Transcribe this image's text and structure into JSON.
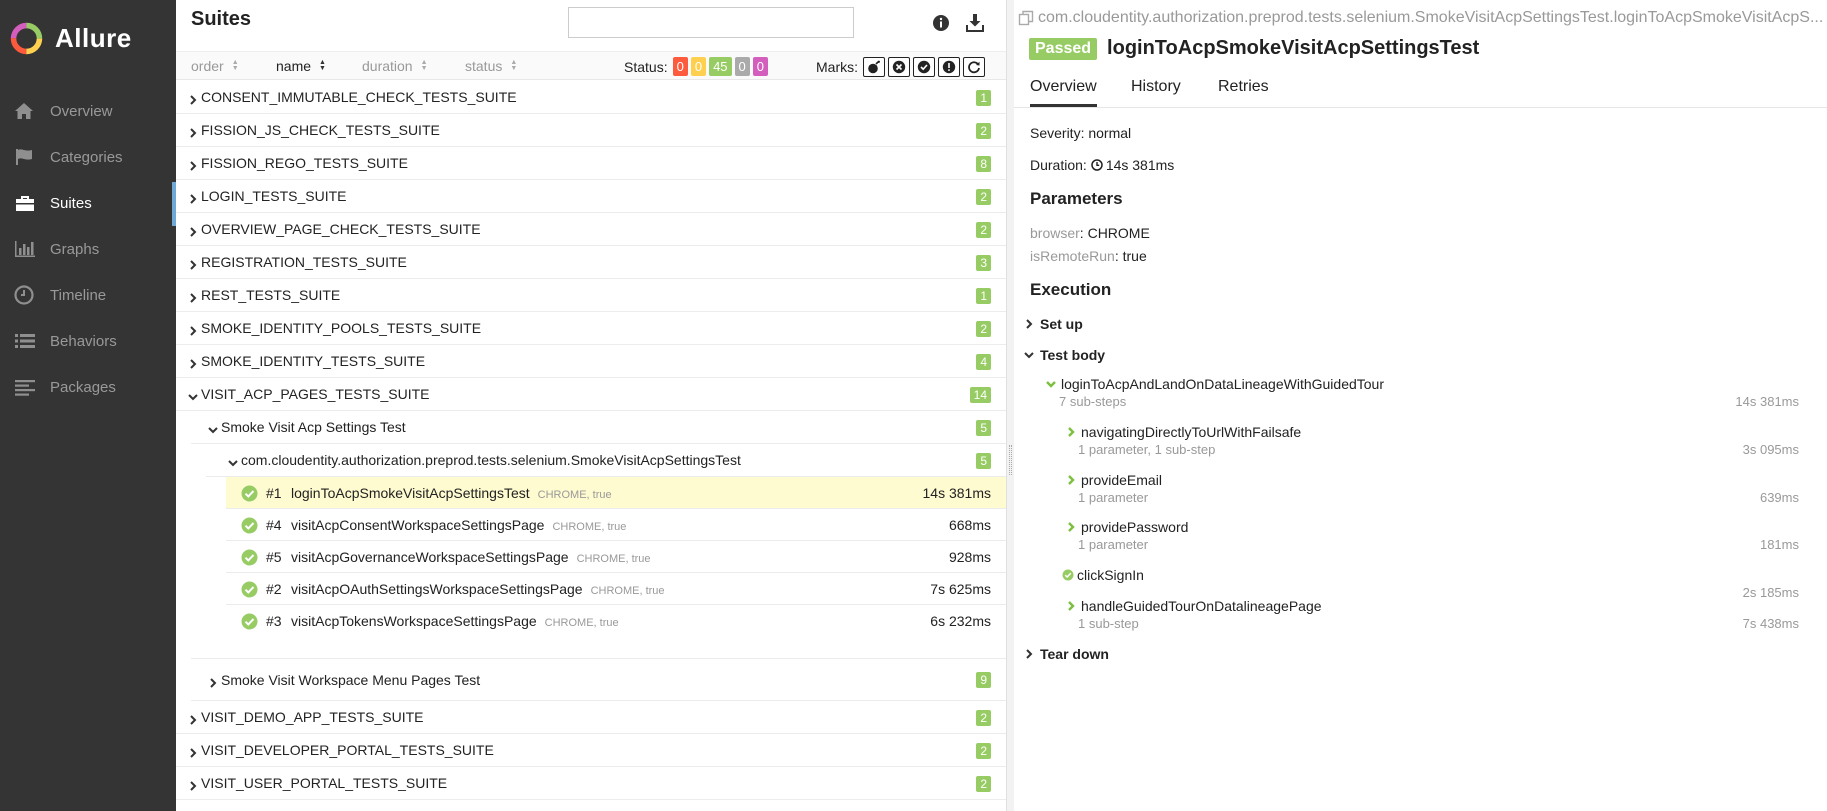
{
  "app": {
    "name": "Allure"
  },
  "sidebar": {
    "items": [
      {
        "label": "Overview",
        "icon": "home-icon",
        "active": false
      },
      {
        "label": "Categories",
        "icon": "flag-icon",
        "active": false
      },
      {
        "label": "Suites",
        "icon": "briefcase-icon",
        "active": true
      },
      {
        "label": "Graphs",
        "icon": "bar-chart-icon",
        "active": false
      },
      {
        "label": "Timeline",
        "icon": "clock-icon",
        "active": false
      },
      {
        "label": "Behaviors",
        "icon": "list-icon",
        "active": false
      },
      {
        "label": "Packages",
        "icon": "align-left-icon",
        "active": false
      }
    ]
  },
  "suites_pane": {
    "title": "Suites",
    "search": {
      "value": "",
      "placeholder": ""
    },
    "sort": {
      "order": "order",
      "name": "name",
      "duration": "duration",
      "status": "status"
    },
    "status_label": "Status:",
    "status_counts": [
      {
        "value": "0",
        "color": "#fd5a3e"
      },
      {
        "value": "0",
        "color": "#ffd050"
      },
      {
        "value": "45",
        "color": "#97cc64"
      },
      {
        "value": "0",
        "color": "#aaaaaa"
      },
      {
        "value": "0",
        "color": "#d35ebe"
      }
    ],
    "marks_label": "Marks:",
    "suites": [
      {
        "name": "CONSENT_IMMUTABLE_CHECK_TESTS_SUITE",
        "count": "1"
      },
      {
        "name": "FISSION_JS_CHECK_TESTS_SUITE",
        "count": "2"
      },
      {
        "name": "FISSION_REGO_TESTS_SUITE",
        "count": "8"
      },
      {
        "name": "LOGIN_TESTS_SUITE",
        "count": "2"
      },
      {
        "name": "OVERVIEW_PAGE_CHECK_TESTS_SUITE",
        "count": "2"
      },
      {
        "name": "REGISTRATION_TESTS_SUITE",
        "count": "3"
      },
      {
        "name": "REST_TESTS_SUITE",
        "count": "1"
      },
      {
        "name": "SMOKE_IDENTITY_POOLS_TESTS_SUITE",
        "count": "2"
      },
      {
        "name": "SMOKE_IDENTITY_TESTS_SUITE",
        "count": "4"
      },
      {
        "name": "VISIT_ACP_PAGES_TESTS_SUITE",
        "count": "14"
      }
    ],
    "sub_suite": {
      "name": "Smoke Visit Acp Settings Test",
      "count": "5"
    },
    "class_node": {
      "name": "com.cloudentity.authorization.preprod.tests.selenium.SmokeVisitAcpSettingsTest",
      "count": "5"
    },
    "test_cases": [
      {
        "order": "#1",
        "name": "loginToAcpSmokeVisitAcpSettingsTest",
        "params": "CHROME, true",
        "duration": "14s 381ms",
        "selected": true
      },
      {
        "order": "#4",
        "name": "visitAcpConsentWorkspaceSettingsPage",
        "params": "CHROME, true",
        "duration": "668ms"
      },
      {
        "order": "#5",
        "name": "visitAcpGovernanceWorkspaceSettingsPage",
        "params": "CHROME, true",
        "duration": "928ms"
      },
      {
        "order": "#2",
        "name": "visitAcpOAuthSettingsWorkspaceSettingsPage",
        "params": "CHROME, true",
        "duration": "7s 625ms"
      },
      {
        "order": "#3",
        "name": "visitAcpTokensWorkspaceSettingsPage",
        "params": "CHROME, true",
        "duration": "6s 232ms"
      }
    ],
    "sub_suite_2": {
      "name": "Smoke Visit Workspace Menu Pages Test",
      "count": "9"
    },
    "suites_after": [
      {
        "name": "VISIT_DEMO_APP_TESTS_SUITE",
        "count": "2"
      },
      {
        "name": "VISIT_DEVELOPER_PORTAL_TESTS_SUITE",
        "count": "2"
      },
      {
        "name": "VISIT_USER_PORTAL_TESTS_SUITE",
        "count": "2"
      }
    ]
  },
  "detail": {
    "breadcrumb": "com.cloudentity.authorization.preprod.tests.selenium.SmokeVisitAcpSettingsTest.loginToAcpSmokeVisitAcpS...",
    "status": "Passed",
    "title": "loginToAcpSmokeVisitAcpSettingsTest",
    "tabs": [
      "Overview",
      "History",
      "Retries"
    ],
    "severity_label": "Severity:",
    "severity_value": "normal",
    "duration_label": "Duration:",
    "duration_value": "14s 381ms",
    "parameters_heading": "Parameters",
    "parameters": [
      {
        "key": "browser",
        "value": "CHROME"
      },
      {
        "key": "isRemoteRun",
        "value": "true"
      }
    ],
    "execution_heading": "Execution",
    "setup_label": "Set up",
    "testbody_label": "Test body",
    "teardown_label": "Tear down",
    "root_step": {
      "name": "loginToAcpAndLandOnDataLineageWithGuidedTour",
      "meta": "7 sub-steps",
      "duration": "14s 381ms"
    },
    "steps": [
      {
        "name": "navigatingDirectlyToUrlWithFailsafe",
        "meta": "1 parameter, 1 sub-step",
        "duration": "3s 095ms",
        "kind": "expand"
      },
      {
        "name": "provideEmail",
        "meta": "1 parameter",
        "duration": "639ms",
        "kind": "expand"
      },
      {
        "name": "providePassword",
        "meta": "1 parameter",
        "duration": "181ms",
        "kind": "expand"
      },
      {
        "name": "clickSignIn",
        "meta": "",
        "duration": "2s 185ms",
        "kind": "passed"
      },
      {
        "name": "handleGuidedTourOnDatalineagePage",
        "meta": "1 sub-step",
        "duration": "7s 438ms",
        "kind": "expand"
      }
    ]
  },
  "colors": {
    "passed": "#97cc64",
    "sidebar_bg": "#343434",
    "selected_row": "#fffbd0"
  }
}
